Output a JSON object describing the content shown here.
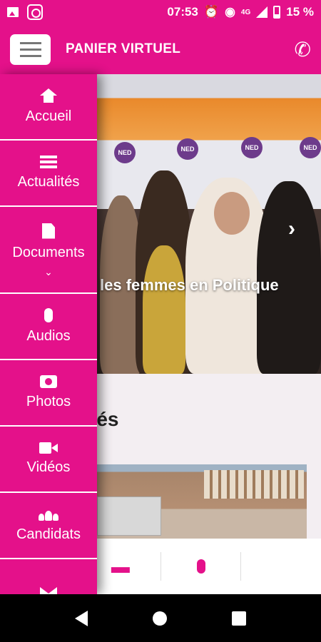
{
  "status_bar": {
    "time": "07:53",
    "network": "4G",
    "battery": "15 %"
  },
  "app_bar": {
    "title": "PANIER VIRTUEL"
  },
  "hero": {
    "caption": "les femmes en Politique"
  },
  "section": {
    "title": "tés"
  },
  "drawer": {
    "items": [
      {
        "label": "Accueil",
        "icon": "home-icon"
      },
      {
        "label": "Actualités",
        "icon": "list-icon"
      },
      {
        "label": "Documents",
        "icon": "pdf-icon",
        "chevron": "⌄"
      },
      {
        "label": "Audios",
        "icon": "microphone-icon"
      },
      {
        "label": "Photos",
        "icon": "camera-icon"
      },
      {
        "label": "Vidéos",
        "icon": "video-icon"
      },
      {
        "label": "Candidats",
        "icon": "group-icon"
      },
      {
        "label": "",
        "icon": "envelope-icon"
      }
    ]
  },
  "bottom_tools": [
    "folder-icon",
    "microphone-icon",
    "video-icon"
  ],
  "colors": {
    "accent": "#e4118a",
    "background": "#f3eef2"
  }
}
